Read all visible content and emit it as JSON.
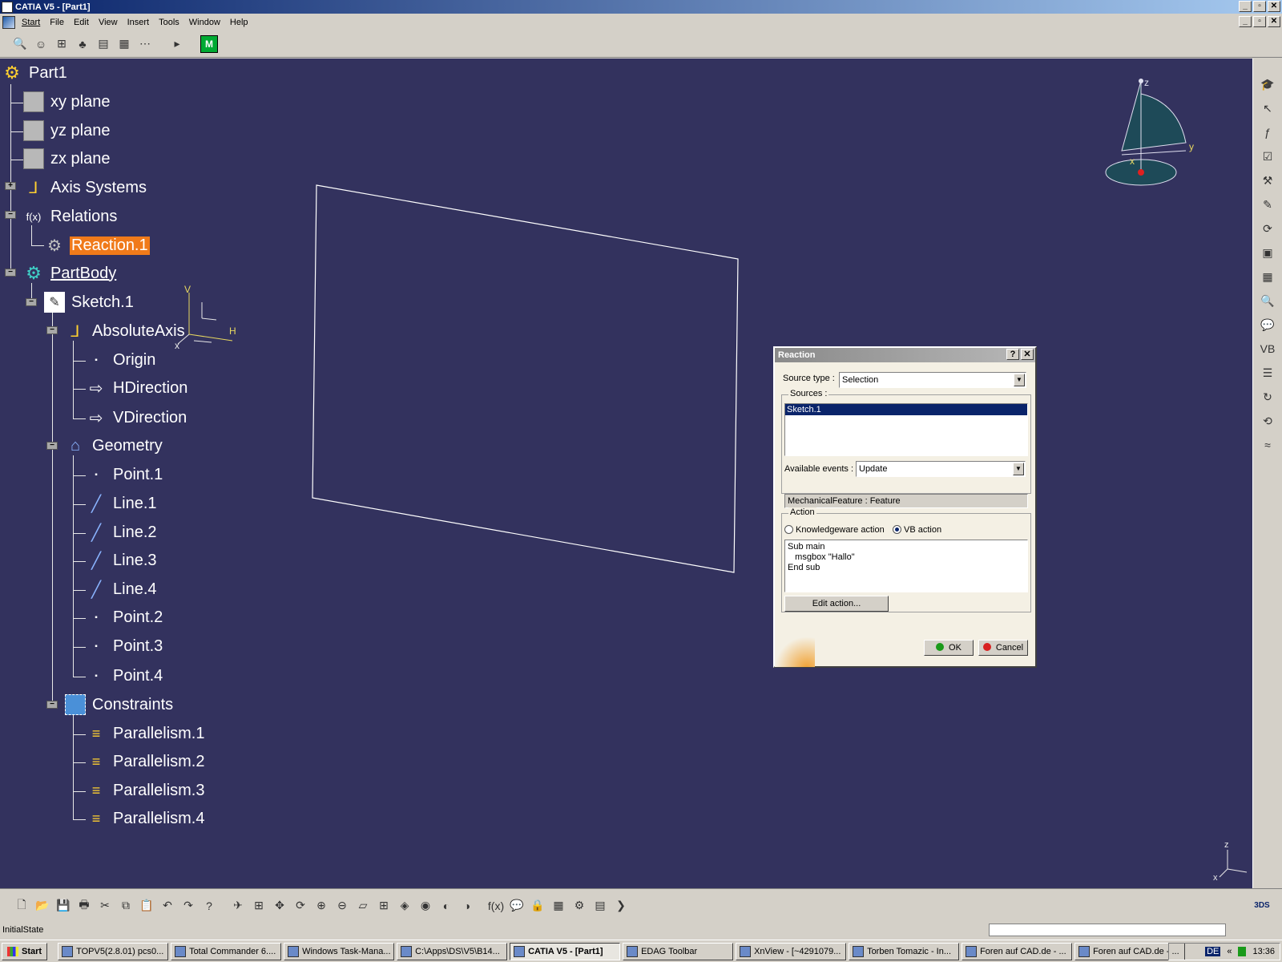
{
  "window": {
    "title": "CATIA V5 - [Part1]"
  },
  "menu": [
    "Start",
    "File",
    "Edit",
    "View",
    "Insert",
    "Tools",
    "Window",
    "Help"
  ],
  "tree": {
    "root": "Part1",
    "xy_plane": "xy plane",
    "yz_plane": "yz plane",
    "zx_plane": "zx plane",
    "axis_systems": "Axis Systems",
    "relations": "Relations",
    "reaction": "Reaction.1",
    "partbody": "PartBody",
    "sketch": "Sketch.1",
    "absolute_axis": "AbsoluteAxis",
    "origin": "Origin",
    "hdirection": "HDirection",
    "vdirection": "VDirection",
    "geometry": "Geometry",
    "point1": "Point.1",
    "line1": "Line.1",
    "line2": "Line.2",
    "line3": "Line.3",
    "line4": "Line.4",
    "point2": "Point.2",
    "point3": "Point.3",
    "point4": "Point.4",
    "constraints": "Constraints",
    "par1": "Parallelism.1",
    "par2": "Parallelism.2",
    "par3": "Parallelism.3",
    "par4": "Parallelism.4"
  },
  "compass": {
    "z": "z",
    "y": "y",
    "x": "x"
  },
  "sketch_axis": {
    "v": "V",
    "h": "H",
    "x": "x"
  },
  "corner_axis": {
    "z": "z",
    "x": "x"
  },
  "dialog": {
    "title": "Reaction",
    "help_btn": "?",
    "close_btn": "✕",
    "source_type_label": "Source type :",
    "source_type_value": "Selection",
    "sources_label": "Sources :",
    "sources_items": [
      "Sketch.1"
    ],
    "available_events_label": "Available events :",
    "available_events_value": "Update",
    "feature_info": "MechanicalFeature :   Feature",
    "action_label": "Action",
    "radio_kw": "Knowledgeware action",
    "radio_vb": "VB action",
    "selected_action": "VB action",
    "code": "Sub main\n   msgbox \"Hallo\"\nEnd sub",
    "edit_action_btn": "Edit action...",
    "ok_btn": "OK",
    "cancel_btn": "Cancel"
  },
  "status": {
    "text": "InitialState"
  },
  "taskbar": {
    "start": "Start",
    "tasks": [
      "TOPV5(2.8.01) pcs0...",
      "Total Commander 6....",
      "Windows Task-Mana...",
      "C:\\Apps\\DS\\V5\\B14...",
      "CATIA V5 - [Part1]",
      "EDAG Toolbar",
      "XnView - [~4291079...",
      "Torben Tomazic - In...",
      "Foren auf CAD.de - ...",
      "Foren auf CAD.de - ..."
    ],
    "active_task": "CATIA V5 - [Part1]",
    "lang": "DE",
    "time": "13:36"
  },
  "colors": {
    "viewport_bg": "#33325e",
    "selection": "#f07a1a",
    "title_bar": "#0a246a"
  },
  "icons": {
    "top_toolbar": [
      "search-icon",
      "identity-icon",
      "tree-icon",
      "tree-toggle-icon",
      "filter-icon",
      "document-icon",
      "dots-icon",
      "play-icon",
      "macro-icon"
    ]
  }
}
